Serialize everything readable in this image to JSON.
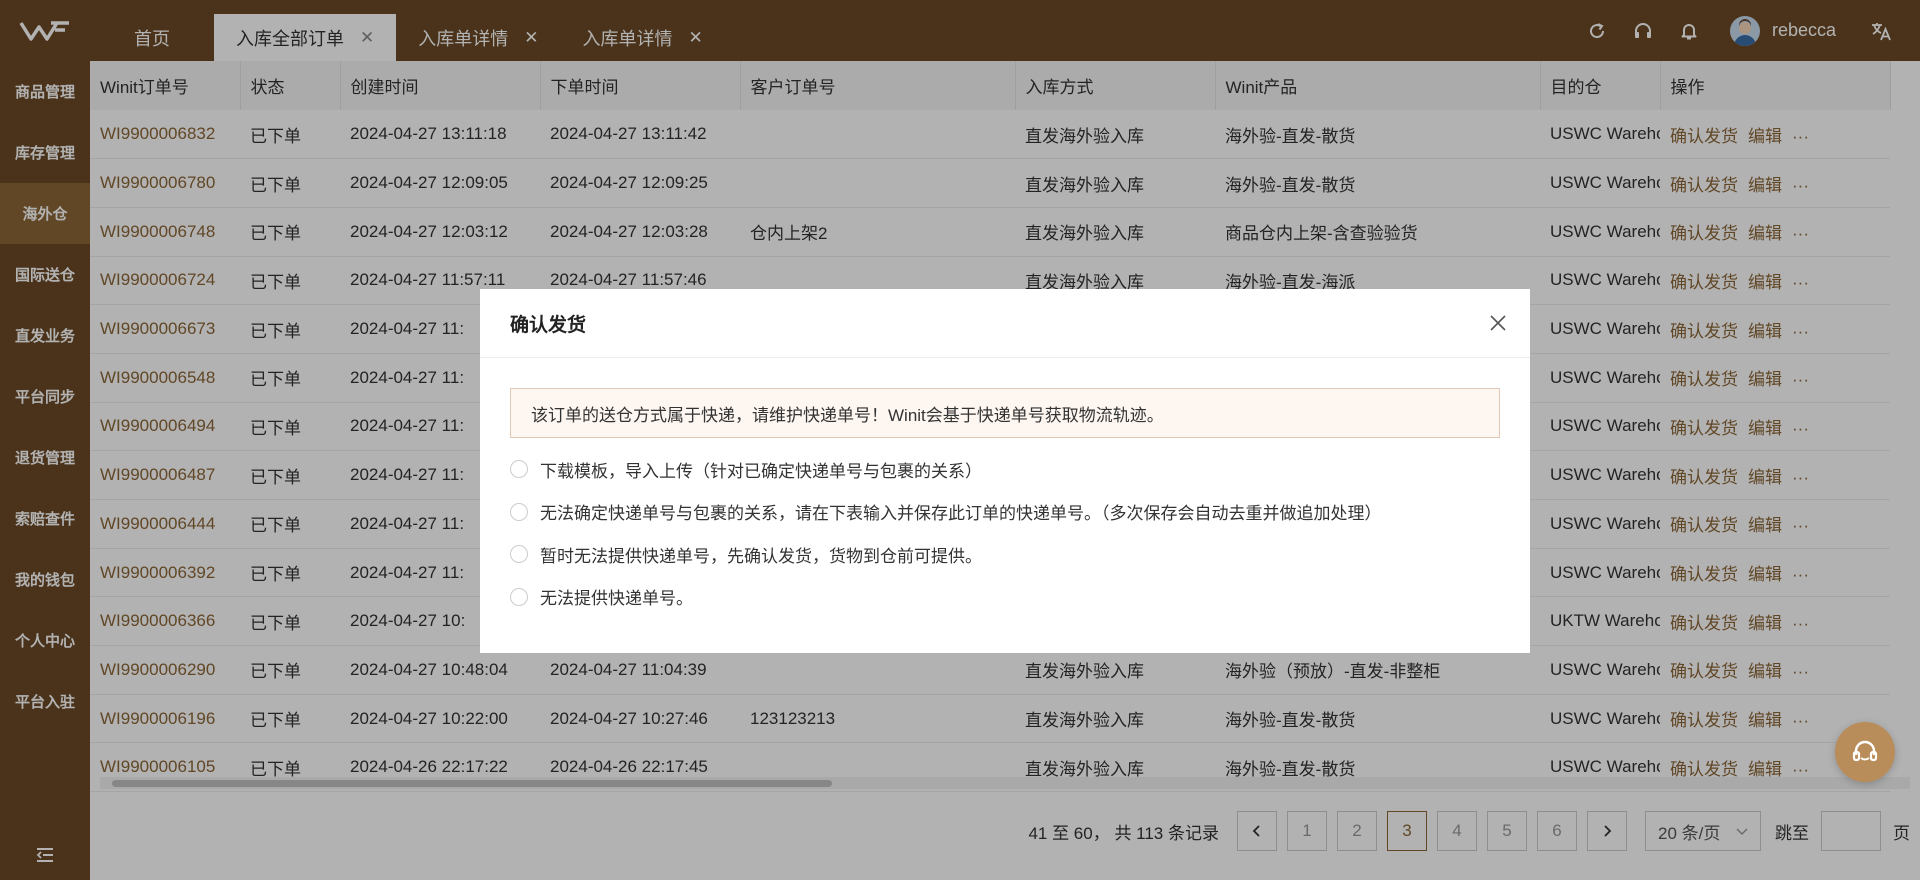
{
  "tabs": [
    {
      "label": "首页",
      "closable": false
    },
    {
      "label": "入库全部订单",
      "closable": true
    },
    {
      "label": "入库单详情",
      "closable": true
    },
    {
      "label": "入库单详情",
      "closable": true
    }
  ],
  "user": {
    "name": "rebecca"
  },
  "sidebar": {
    "items": [
      {
        "label": "商品管理"
      },
      {
        "label": "库存管理"
      },
      {
        "label": "海外仓"
      },
      {
        "label": "国际送仓"
      },
      {
        "label": "直发业务"
      },
      {
        "label": "平台同步"
      },
      {
        "label": "退货管理"
      },
      {
        "label": "索赔查件"
      },
      {
        "label": "我的钱包"
      },
      {
        "label": "个人中心"
      },
      {
        "label": "平台入驻"
      }
    ]
  },
  "table": {
    "headers": [
      "Winit订单号",
      "状态",
      "创建时间",
      "下单时间",
      "客户订单号",
      "入库方式",
      "Winit产品",
      "目的仓",
      "操作"
    ],
    "rows": [
      [
        "WI9900006832",
        "已下单",
        "2024-04-27 13:11:18",
        "2024-04-27 13:11:42",
        "",
        "直发海外验入库",
        "海外验-直发-散货",
        "USWC Wareho"
      ],
      [
        "WI9900006780",
        "已下单",
        "2024-04-27 12:09:05",
        "2024-04-27 12:09:25",
        "",
        "直发海外验入库",
        "海外验-直发-散货",
        "USWC Wareho"
      ],
      [
        "WI9900006748",
        "已下单",
        "2024-04-27 12:03:12",
        "2024-04-27 12:03:28",
        "仓内上架2",
        "直发海外验入库",
        "商品仓内上架-含查验验货",
        "USWC Wareho"
      ],
      [
        "WI9900006724",
        "已下单",
        "2024-04-27 11:57:11",
        "2024-04-27 11:57:46",
        "",
        "直发海外验入库",
        "海外验-直发-海派",
        "USWC Wareho"
      ],
      [
        "WI9900006673",
        "已下单",
        "2024-04-27 11:",
        "",
        "",
        "",
        "",
        "USWC Wareho"
      ],
      [
        "WI9900006548",
        "已下单",
        "2024-04-27 11:",
        "",
        "",
        "",
        "",
        "USWC Wareho"
      ],
      [
        "WI9900006494",
        "已下单",
        "2024-04-27 11:",
        "",
        "",
        "",
        "",
        "USWC Wareho"
      ],
      [
        "WI9900006487",
        "已下单",
        "2024-04-27 11:",
        "",
        "",
        "",
        "",
        "USWC Wareho"
      ],
      [
        "WI9900006444",
        "已下单",
        "2024-04-27 11:",
        "",
        "",
        "",
        "",
        "USWC Wareho"
      ],
      [
        "WI9900006392",
        "已下单",
        "2024-04-27 11:",
        "",
        "",
        "",
        "",
        "USWC Wareho"
      ],
      [
        "WI9900006366",
        "已下单",
        "2024-04-27 10:",
        "",
        "",
        "",
        "",
        "UKTW Wareho"
      ],
      [
        "WI9900006290",
        "已下单",
        "2024-04-27 10:48:04",
        "2024-04-27 11:04:39",
        "",
        "直发海外验入库",
        "海外验（预放）-直发-非整柜",
        "USWC Wareho"
      ],
      [
        "WI9900006196",
        "已下单",
        "2024-04-27 10:22:00",
        "2024-04-27 10:27:46",
        "123123213",
        "直发海外验入库",
        "海外验-直发-散货",
        "USWC Wareho"
      ],
      [
        "WI9900006105",
        "已下单",
        "2024-04-26 22:17:22",
        "2024-04-26 22:17:45",
        "",
        "直发海外验入库",
        "海外验-直发-散货",
        "USWC Wareho"
      ]
    ],
    "op_confirm": "确认发货",
    "op_edit": "编辑",
    "op_more": "···"
  },
  "pagination": {
    "summary": "41 至 60，  共 113 条记录",
    "pages": [
      "1",
      "2",
      "3",
      "4",
      "5",
      "6"
    ],
    "current": "3",
    "page_size": "20 条/页",
    "jump_label": "跳至",
    "page_suffix": "页"
  },
  "modal": {
    "title": "确认发货",
    "alert": "该订单的送仓方式属于快递，请维护快递单号！Winit会基于快递单号获取物流轨迹。",
    "options": [
      "下载模板，导入上传（针对已确定快递单号与包裹的关系）",
      "无法确定快递单号与包裹的关系，请在下表输入并保存此订单的快递单号。（多次保存会自动去重并做追加处理）",
      "暂时无法提供快递单号，先确认发货，货物到仓前可提供。",
      "无法提供快递单号。"
    ]
  },
  "colors": {
    "brand": "#6b4a26",
    "accent": "#8b6637",
    "active_side": "#8b6637"
  }
}
